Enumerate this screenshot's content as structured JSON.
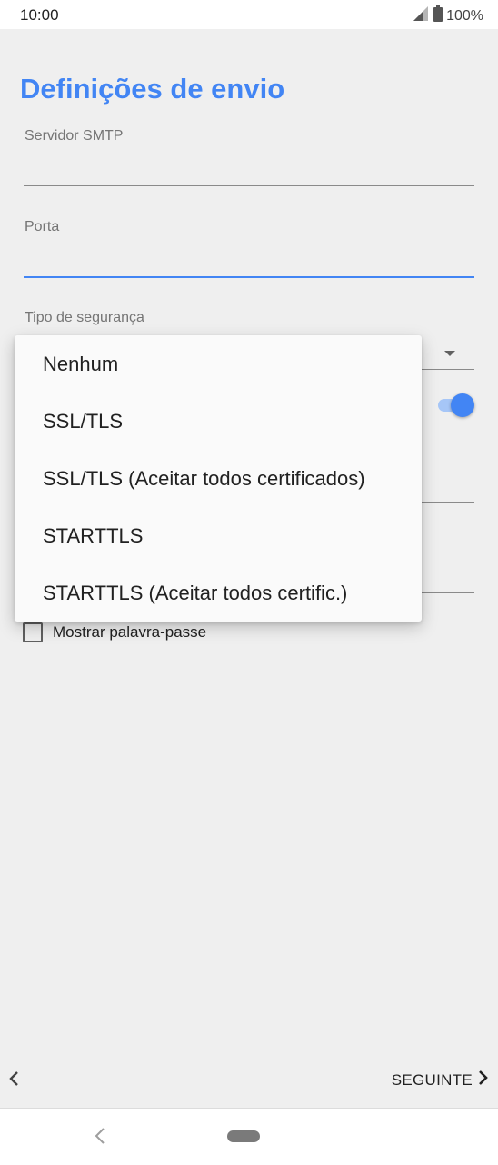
{
  "status_bar": {
    "time": "10:00",
    "battery": "100%"
  },
  "page": {
    "title": "Definições de envio"
  },
  "fields": {
    "smtp_label": "Servidor SMTP",
    "port_label": "Porta",
    "security_label": "Tipo de segurança"
  },
  "checkbox": {
    "label": "Mostrar palavra-passe",
    "checked": false
  },
  "toggle": {
    "on": true
  },
  "menu": {
    "items": [
      "Nenhum",
      "SSL/TLS",
      "SSL/TLS (Aceitar todos certificados)",
      "STARTTLS",
      "STARTTLS (Aceitar todos certific.)"
    ]
  },
  "nav": {
    "next_label": "SEGUINTE"
  },
  "colors": {
    "accent": "#4285f4",
    "background": "#efefef",
    "menu_background": "#fafafa"
  }
}
